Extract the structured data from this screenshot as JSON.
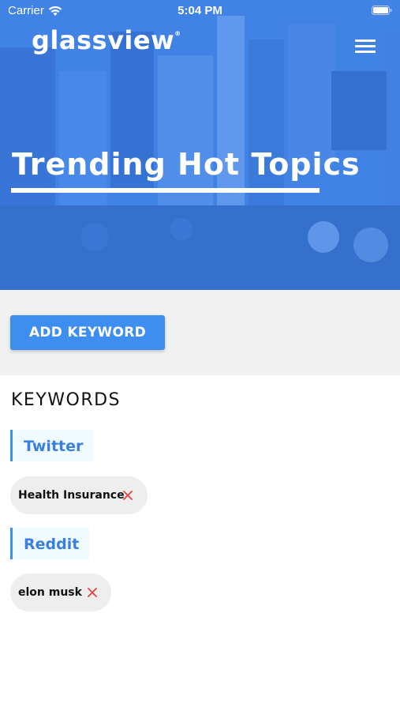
{
  "status_bar": {
    "carrier": "Carrier",
    "time": "5:04 PM"
  },
  "header": {
    "logo": "glassview",
    "logo_mark": "®",
    "title": "Trending Hot Topics"
  },
  "actions": {
    "add_keyword_label": "ADD KEYWORD"
  },
  "keywords": {
    "heading": "KEYWORDS",
    "groups": [
      {
        "source": "Twitter",
        "items": [
          "Health Insurance"
        ]
      },
      {
        "source": "Reddit",
        "items": [
          "elon musk"
        ]
      }
    ]
  },
  "colors": {
    "accent": "#3e8ef0",
    "remove": "#e8453c",
    "hero_overlay": "#3b80eb"
  },
  "icons": {
    "wifi": "wifi-icon",
    "battery": "battery-icon",
    "menu": "hamburger-menu-icon",
    "remove": "close-icon"
  }
}
